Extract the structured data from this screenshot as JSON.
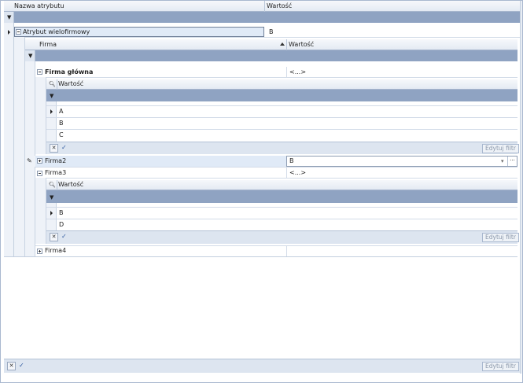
{
  "columns": {
    "name": "Nazwa atrybutu",
    "value": "Wartość"
  },
  "attr_row": {
    "name": "Atrybut wielofirmowy",
    "value": "B"
  },
  "firma_grid": {
    "col_firma": "Firma",
    "col_value": "Wartość",
    "rows": [
      {
        "name": "Firma główna",
        "value": "<...>"
      },
      {
        "name": "Firma2",
        "value": "B"
      },
      {
        "name": "Firma3",
        "value": "<...>"
      },
      {
        "name": "Firma4",
        "value": ""
      }
    ]
  },
  "detail1": {
    "col_value": "Wartość",
    "rows": [
      "A",
      "B",
      "C"
    ],
    "edit_filter": "Edytuj filtr"
  },
  "detail2": {
    "col_value": "Wartość",
    "rows": [
      "B",
      "D"
    ],
    "edit_filter": "Edytuj filtr"
  },
  "footer": {
    "edit_filter": "Edytuj filtr"
  },
  "icons": {
    "filter": "funnel-icon",
    "search": "magnifier-icon",
    "close": "x-icon",
    "check": "check-icon",
    "edit": "pencil-icon",
    "row_pointer": "triangle-right-icon",
    "expand": "plus-box-icon",
    "collapse": "minus-box-icon"
  }
}
